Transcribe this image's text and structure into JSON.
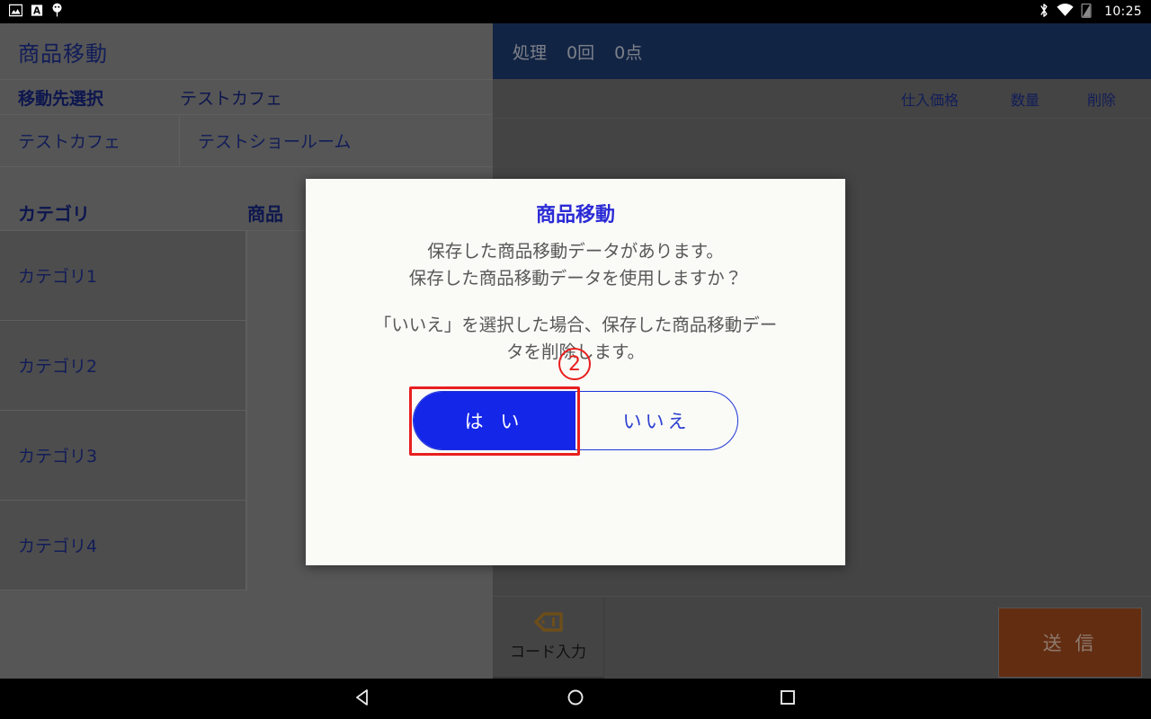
{
  "status_bar": {
    "notification_icons": [
      "image-icon",
      "text-input-icon",
      "usb-debug-icon"
    ],
    "system_icons": [
      "bluetooth-icon",
      "wifi-icon",
      "battery-icon"
    ],
    "clock": "10:25"
  },
  "app": {
    "title": "商品移動",
    "destination": {
      "label": "移動先選択",
      "selected": "テストカフェ",
      "options": [
        "テストカフェ",
        "テストショールーム"
      ]
    },
    "columns": {
      "category": "カテゴリ",
      "product": "商品"
    },
    "categories": [
      {
        "label": "カテゴリ1"
      },
      {
        "label": "カテゴリ2"
      },
      {
        "label": "カテゴリ3"
      },
      {
        "label": "カテゴリ4"
      }
    ]
  },
  "right_panel": {
    "process_bar": {
      "label": "処理",
      "count": "0回",
      "items": "0点"
    },
    "table_headers": [
      "仕入価格",
      "数量",
      "削除"
    ],
    "rows": []
  },
  "bottom_bar": {
    "code_input": {
      "label": "コード入力",
      "icon": "tag-icon"
    },
    "send": {
      "label": "送 信",
      "color": "#a04a1d"
    }
  },
  "dialog": {
    "title": "商品移動",
    "message_line1": "保存した商品移動データがあります。",
    "message_line2": "保存した商品移動データを使用しますか？",
    "message_line3": "「いいえ」を選択した場合、保存した商品移動デー",
    "message_line4": "タを削除します。",
    "yes_label": "は い",
    "no_label": "いいえ",
    "annotation_number": "②",
    "accent_color": "#1426e8",
    "annotation_color": "#e81f1f"
  },
  "nav_bar": {
    "back": "back-icon",
    "home": "home-icon",
    "recents": "recents-icon"
  }
}
